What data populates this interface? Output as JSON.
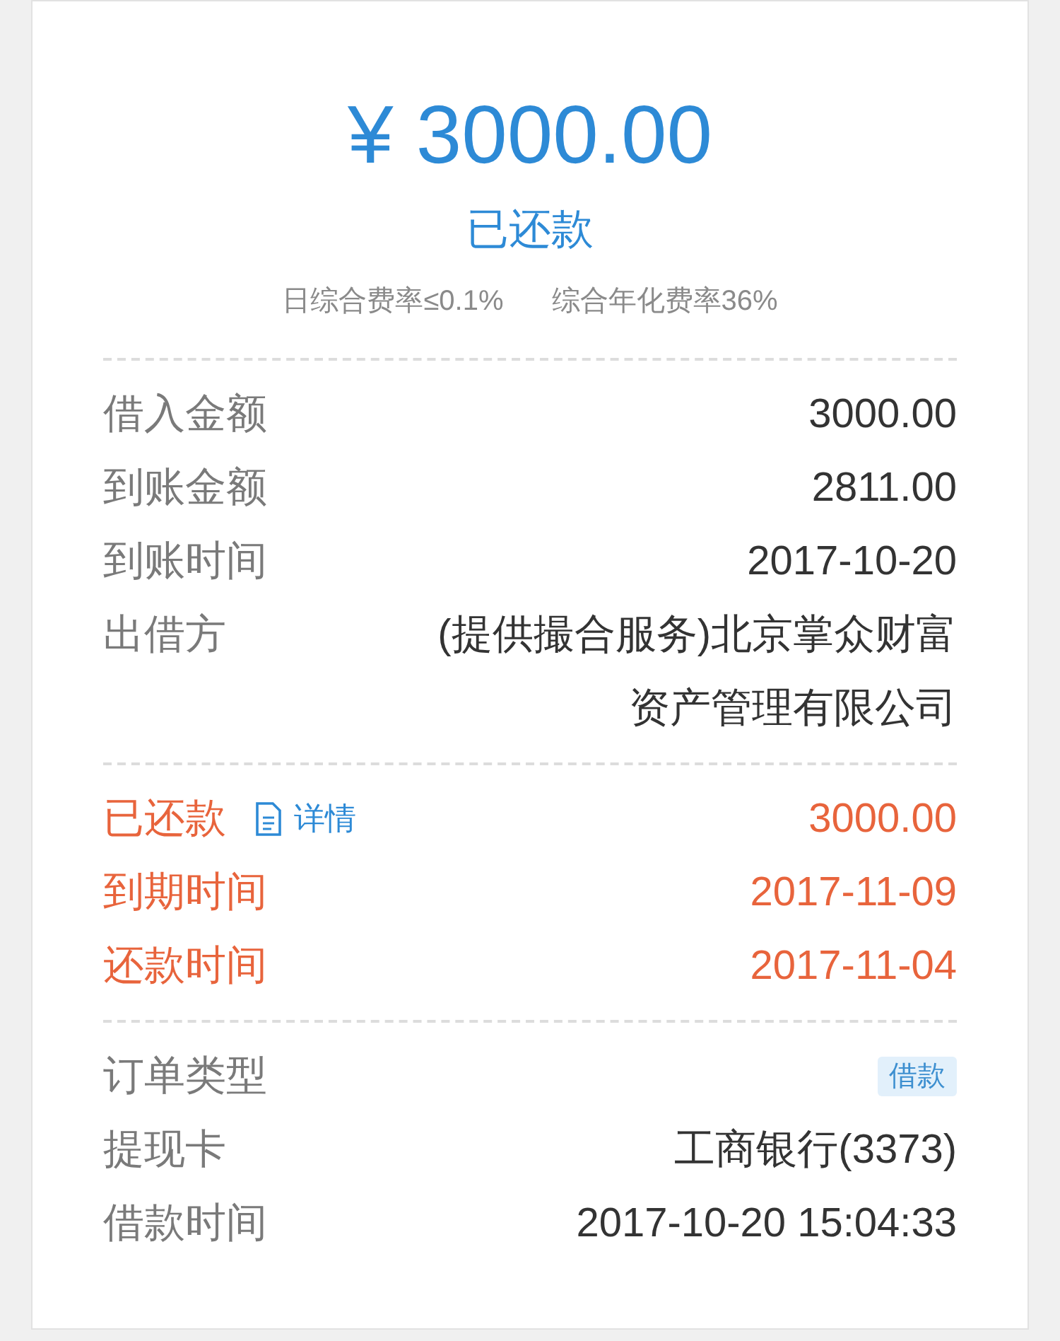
{
  "amount": "¥ 3000.00",
  "status": "已还款",
  "rates": [
    "日综合费率≤0.1%",
    "综合年化费率36%"
  ],
  "sections": [
    {
      "highlight": false,
      "rows": [
        {
          "kind": "plain",
          "label": "借入金额",
          "value": "3000.00"
        },
        {
          "kind": "plain",
          "label": "到账金额",
          "value": "2811.00"
        },
        {
          "kind": "plain",
          "label": "到账时间",
          "value": "2017-10-20"
        },
        {
          "kind": "plain",
          "label": "出借方",
          "value": "(提供撮合服务)北京掌众财富资产管理有限公司"
        }
      ]
    },
    {
      "highlight": true,
      "rows": [
        {
          "kind": "detail",
          "label": "已还款",
          "link": "详情",
          "value": "3000.00"
        },
        {
          "kind": "plain",
          "label": "到期时间",
          "value": "2017-11-09"
        },
        {
          "kind": "plain",
          "label": "还款时间",
          "value": "2017-11-04"
        }
      ]
    },
    {
      "highlight": false,
      "rows": [
        {
          "kind": "tag",
          "label": "订单类型",
          "value": "借款"
        },
        {
          "kind": "plain",
          "label": "提现卡",
          "value": "工商银行(3373)"
        },
        {
          "kind": "plain",
          "label": "借款时间",
          "value": "2017-10-20 15:04:33"
        }
      ]
    }
  ]
}
